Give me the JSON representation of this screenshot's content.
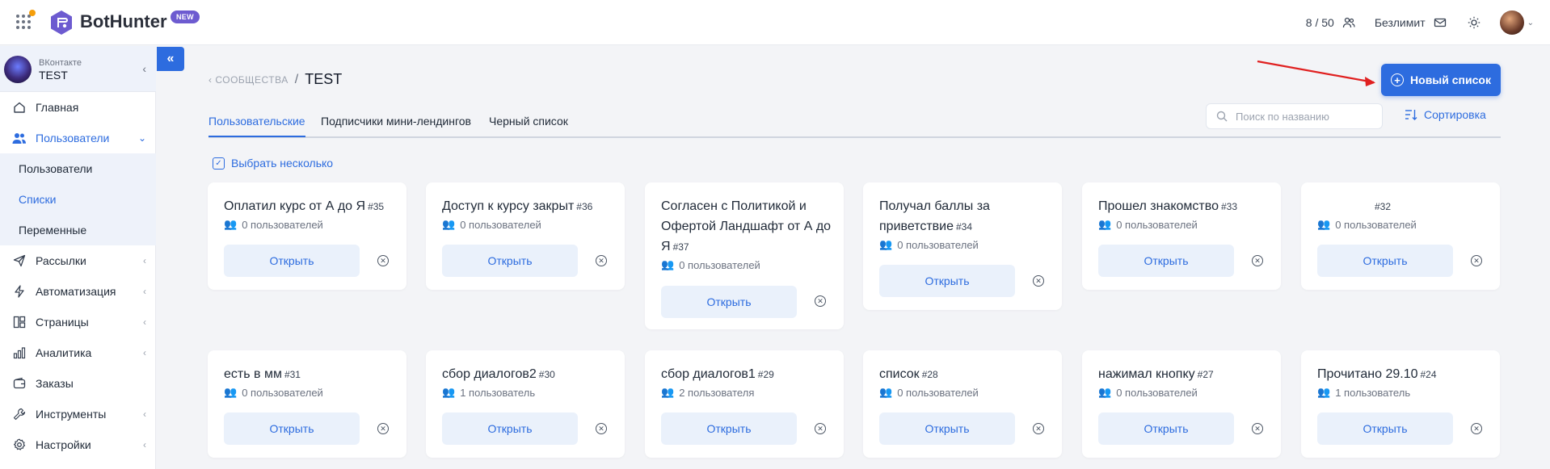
{
  "header": {
    "app_name": "BotHunter",
    "new_badge": "NEW",
    "quota": "8 / 50",
    "plan": "Безлимит"
  },
  "sidebar": {
    "account_network": "ВКонтакте",
    "account_name": "TEST",
    "items": [
      {
        "label": "Главная",
        "icon": "home-icon"
      },
      {
        "label": "Пользователи",
        "icon": "users-icon"
      },
      {
        "label": "Пользователи"
      },
      {
        "label": "Списки"
      },
      {
        "label": "Переменные"
      },
      {
        "label": "Рассылки",
        "icon": "send-icon"
      },
      {
        "label": "Автоматизация",
        "icon": "lightning-icon"
      },
      {
        "label": "Страницы",
        "icon": "pages-icon"
      },
      {
        "label": "Аналитика",
        "icon": "chart-icon"
      },
      {
        "label": "Заказы",
        "icon": "wallet-icon"
      },
      {
        "label": "Инструменты",
        "icon": "wrench-icon"
      },
      {
        "label": "Настройки",
        "icon": "gear-icon"
      }
    ]
  },
  "breadcrumb": {
    "back_label": "СООБЩЕСТВА",
    "separator": "/",
    "current": "TEST"
  },
  "actions": {
    "new_list_label": "Новый список",
    "search_placeholder": "Поиск по названию",
    "sort_label": "Сортировка",
    "select_multiple_label": "Выбрать несколько"
  },
  "tabs": [
    "Пользовательские",
    "Подписчики мини-лендингов",
    "Черный список"
  ],
  "open_label": "Открыть",
  "cards": [
    {
      "title": "Оплатил курс от А до Я",
      "num": "#35",
      "count": "0 пользователей"
    },
    {
      "title": "Доступ к курсу закрыт",
      "num": "#36",
      "count": "0 пользователей"
    },
    {
      "title": "Согласен с Политикой и Офертой Ландшафт от А до Я",
      "num": "#37",
      "count": "0 пользователей"
    },
    {
      "title": "Получал баллы за приветствие",
      "num": "#34",
      "count": "0 пользователей"
    },
    {
      "title": "Прошел знакомство",
      "num": "#33",
      "count": "0 пользователей"
    },
    {
      "title": "",
      "num": "#32",
      "count": "0 пользователей"
    },
    {
      "title": "есть в мм",
      "num": "#31",
      "count": "0 пользователей"
    },
    {
      "title": "сбор диалогов2",
      "num": "#30",
      "count": "1 пользователь"
    },
    {
      "title": "сбор диалогов1",
      "num": "#29",
      "count": "2 пользователя"
    },
    {
      "title": "список",
      "num": "#28",
      "count": "0 пользователей"
    },
    {
      "title": "нажимал кнопку",
      "num": "#27",
      "count": "0 пользователей"
    },
    {
      "title": "Прочитано 29.10",
      "num": "#24",
      "count": "1 пользователь"
    }
  ],
  "colors": {
    "accent": "#2d6cdf",
    "badge": "#6d5bd0",
    "annotation_arrow": "#e02020"
  }
}
